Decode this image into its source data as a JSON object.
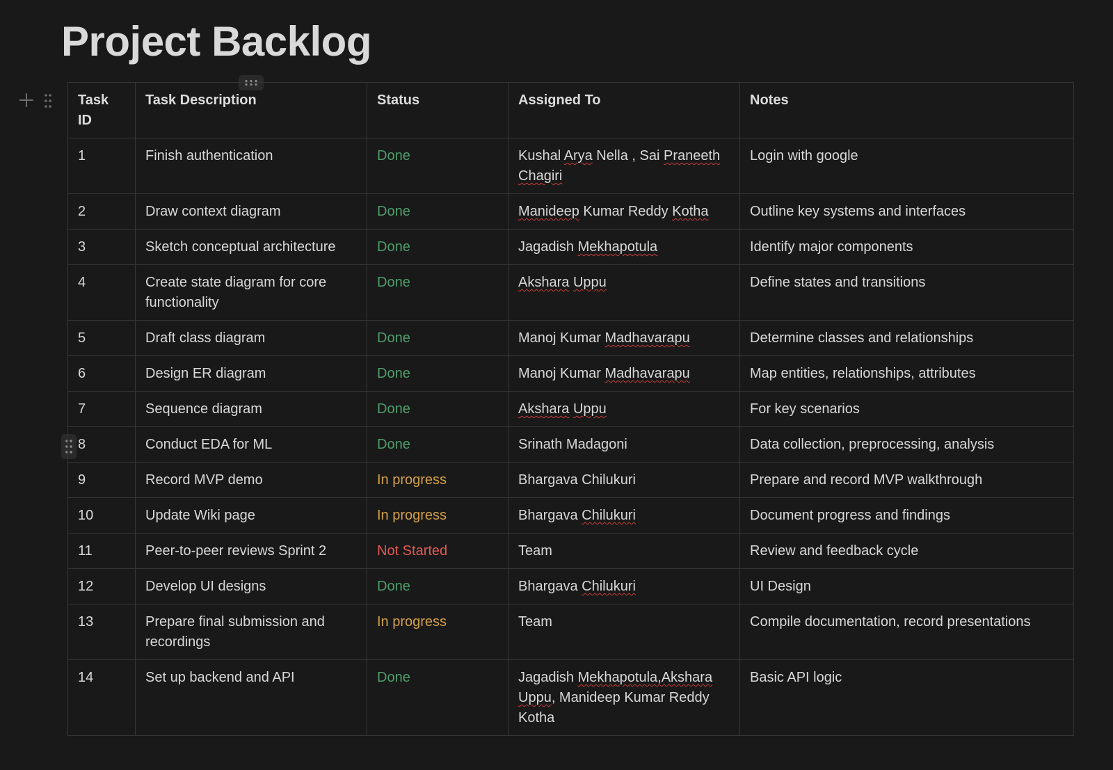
{
  "page": {
    "title": "Project Backlog"
  },
  "colors": {
    "background": "#191919",
    "done": "#4f9d6c",
    "in_progress": "#d3a04a",
    "not_started": "#e05a55"
  },
  "icons": {
    "add_row": "plus-icon",
    "row_drag": "drag-handle-icon",
    "column_drag": "column-drag-handle-icon"
  },
  "table": {
    "headers": [
      "Task ID",
      "Task Description",
      "Status",
      "Assigned To",
      "Notes"
    ],
    "rows": [
      {
        "id": "1",
        "description": "Finish authentication",
        "status": "Done",
        "status_kind": "done",
        "assigned": [
          {
            "t": "Kushal "
          },
          {
            "t": "Arya",
            "s": true
          },
          {
            "t": " Nella , Sai "
          },
          {
            "t": "Praneeth",
            "s": true
          },
          {
            "t": " "
          },
          {
            "t": "Chagiri",
            "s": true
          }
        ],
        "notes": "Login with google"
      },
      {
        "id": "2",
        "description": "Draw context diagram",
        "status": "Done",
        "status_kind": "done",
        "assigned": [
          {
            "t": "Manideep",
            "s": true
          },
          {
            "t": " Kumar Reddy "
          },
          {
            "t": "Kotha",
            "s": true
          }
        ],
        "notes": "Outline key systems and interfaces"
      },
      {
        "id": "3",
        "description": "Sketch conceptual architecture",
        "status": "Done",
        "status_kind": "done",
        "assigned": [
          {
            "t": "Jagadish "
          },
          {
            "t": "Mekhapotula",
            "s": true
          }
        ],
        "notes": "Identify major components"
      },
      {
        "id": "4",
        "description": "Create state diagram for core functionality",
        "status": "Done",
        "status_kind": "done",
        "assigned": [
          {
            "t": "Akshara",
            "s": true
          },
          {
            "t": " "
          },
          {
            "t": "Uppu",
            "s": true
          }
        ],
        "notes": "Define states and transitions"
      },
      {
        "id": "5",
        "description": "Draft class diagram",
        "status": "Done",
        "status_kind": "done",
        "assigned": [
          {
            "t": "Manoj Kumar "
          },
          {
            "t": "Madhavarapu",
            "s": true
          }
        ],
        "notes": "Determine classes and relationships"
      },
      {
        "id": "6",
        "description": "Design ER diagram",
        "status": "Done",
        "status_kind": "done",
        "assigned": [
          {
            "t": "Manoj Kumar "
          },
          {
            "t": "Madhavarapu",
            "s": true
          }
        ],
        "notes": "Map entities, relationships, attributes"
      },
      {
        "id": "7",
        "description": "Sequence diagram",
        "status": "Done",
        "status_kind": "done",
        "assigned": [
          {
            "t": "Akshara",
            "s": true
          },
          {
            "t": " "
          },
          {
            "t": "Uppu",
            "s": true
          }
        ],
        "notes": "For key scenarios"
      },
      {
        "id": "8",
        "description": "Conduct EDA for ML",
        "status": "Done",
        "status_kind": "done",
        "assigned": [
          {
            "t": "Srinath Madagoni"
          }
        ],
        "notes": "Data collection, preprocessing, analysis"
      },
      {
        "id": "9",
        "description": "Record MVP demo",
        "status": "In progress",
        "status_kind": "progress",
        "assigned": [
          {
            "t": "Bhargava Chilukuri"
          }
        ],
        "notes": "Prepare and record MVP walkthrough"
      },
      {
        "id": "10",
        "description": "Update Wiki page",
        "status": "In progress",
        "status_kind": "progress",
        "assigned": [
          {
            "t": "Bhargava "
          },
          {
            "t": "Chilukuri",
            "s": true
          }
        ],
        "notes": "Document progress and findings"
      },
      {
        "id": "11",
        "description": "Peer-to-peer reviews Sprint 2",
        "status": "Not Started",
        "status_kind": "not",
        "assigned": [
          {
            "t": "Team"
          }
        ],
        "notes": "Review and feedback cycle"
      },
      {
        "id": "12",
        "description": "Develop UI designs",
        "status": "Done",
        "status_kind": "done",
        "assigned": [
          {
            "t": "Bhargava "
          },
          {
            "t": "Chilukuri",
            "s": true
          }
        ],
        "notes": "UI Design"
      },
      {
        "id": "13",
        "description": "Prepare final submission and recordings",
        "status": "In progress",
        "status_kind": "progress",
        "assigned": [
          {
            "t": "Team"
          }
        ],
        "notes": "Compile documentation, record presentations"
      },
      {
        "id": "14",
        "description": "Set up backend and API",
        "status": "Done",
        "status_kind": "done",
        "assigned": [
          {
            "t": "Jagadish "
          },
          {
            "t": "Mekhapotula,Akshara",
            "s": true
          },
          {
            "t": " "
          },
          {
            "t": "Uppu",
            "s": true
          },
          {
            "t": ", Manideep Kumar Reddy Kotha"
          }
        ],
        "notes": "Basic API logic"
      }
    ]
  }
}
